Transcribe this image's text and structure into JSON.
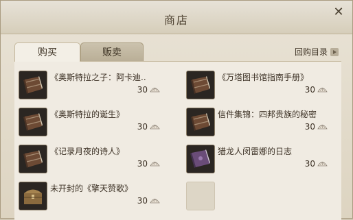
{
  "window": {
    "title": "商店"
  },
  "tabs": {
    "buy": "购买",
    "sell": "贩卖"
  },
  "repurchase_label": "回购目录",
  "items": [
    {
      "name": "《奥斯特拉之子：阿卡迪..",
      "price": "30",
      "icon": "brown-book-icon"
    },
    {
      "name": "《万塔图书馆指南手册》",
      "price": "30",
      "icon": "brown-book-icon"
    },
    {
      "name": "《奥斯特拉的诞生》",
      "price": "30",
      "icon": "brown-book-icon"
    },
    {
      "name": "信件集锦：四邦贵族的秘密",
      "price": "30",
      "icon": "brown-book-icon"
    },
    {
      "name": "《记录月夜的诗人》",
      "price": "30",
      "icon": "brown-book-icon"
    },
    {
      "name": "猎龙人闵雷娜的日志",
      "price": "30",
      "icon": "purple-book-icon"
    },
    {
      "name": "未开封的《擎天赞歌》",
      "price": "30",
      "icon": "treasure-chest-icon"
    }
  ],
  "colors": {
    "accent": "#4b3f2e",
    "panel": "#f0ebe2"
  }
}
